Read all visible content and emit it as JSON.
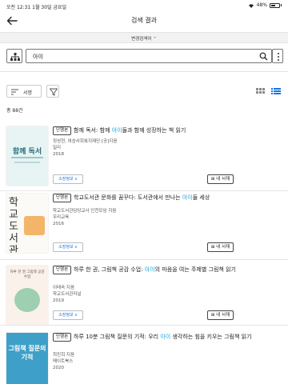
{
  "status_bar": {
    "time": "오전 12:31",
    "date": "1월 30일 금요일",
    "battery": "48%"
  },
  "header": {
    "title": "검색 결과",
    "back_icon": "back-arrow-icon"
  },
  "advanced_search": {
    "label": "변경검색어"
  },
  "search": {
    "query": "아이"
  },
  "sort": {
    "selected": "서명"
  },
  "results": {
    "total": "총 88건"
  },
  "items": [
    {
      "type": "단행본",
      "title_parts": [
        "함께 독서: 함께 ",
        "아이",
        "들과 함께 성장하는 책 읽기"
      ],
      "author": "정성현, 여승사회복지재단 [공]지음",
      "publisher": "일리",
      "year": "2018",
      "own_label": "소장정보 ∨",
      "shelf_label": "내 서재",
      "cover_title": "함께 독서"
    },
    {
      "type": "단행본",
      "title_parts": [
        "학교도서관 문화를 꿈꾸다: 도서관에서 만나는 ",
        "아이",
        "들 세상"
      ],
      "author": "학교도서관담당교사 인천모임 지음",
      "publisher": "우리교육",
      "year": "2016",
      "own_label": "소장정보 ∨",
      "shelf_label": "내 서재",
      "cover_title": "학교도서관"
    },
    {
      "type": "단행본",
      "title_parts": [
        "하루 한 권, 그림책 공감 수업: ",
        "아이",
        "의 마음을 여는 주제별 그림책 읽기"
      ],
      "author": "이태숙 지음",
      "publisher": "학교도서관저널",
      "year": "2019",
      "own_label": "소장정보 ∨",
      "shelf_label": "내 서재",
      "cover_title": "하루 한 권 그림책 공감 수업"
    },
    {
      "type": "단행본",
      "title_parts": [
        "하루 10분 그림책 질문의 기적: 우리 ",
        "아이",
        " 생각하는 힘을 키우는 그림책 읽기"
      ],
      "author": "최진희 지음",
      "publisher": "메이트북스",
      "year": "2020",
      "cover_title": "그림책 질문의 기적"
    }
  ],
  "colors": {
    "highlight": "#18a4e0",
    "link": "#1a73e8"
  }
}
